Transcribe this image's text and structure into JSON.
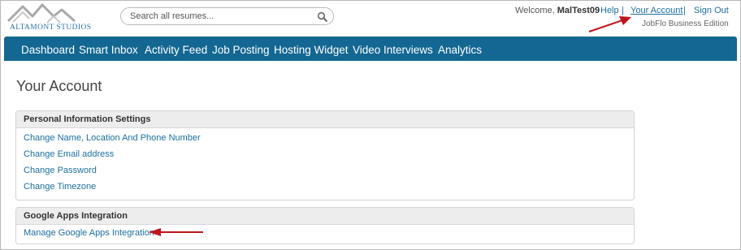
{
  "header": {
    "logo_text": "ALTAMONT STUDIOS",
    "search_placeholder": "Search all resumes...",
    "welcome_prefix": "Welcome,",
    "username": "MalTest09",
    "links": {
      "help": "Help",
      "your_account": "Your Account",
      "sign_out": "Sign Out"
    },
    "separator": "|",
    "edition": "JobFlo Business Edition"
  },
  "nav": {
    "items": [
      "Dashboard",
      "Smart Inbox",
      "Activity Feed",
      "Job Posting",
      "Hosting Widget",
      "Video Interviews",
      "Analytics"
    ],
    "bg_color": "#136792"
  },
  "page": {
    "title": "Your Account"
  },
  "sections": [
    {
      "title": "Personal Information Settings",
      "links": [
        "Change Name, Location And Phone Number",
        "Change Email address",
        "Change Password",
        "Change Timezone"
      ]
    },
    {
      "title": "Google Apps Integration",
      "links": [
        "Manage Google Apps Integration"
      ]
    }
  ],
  "annotation_color": "#c0141b"
}
